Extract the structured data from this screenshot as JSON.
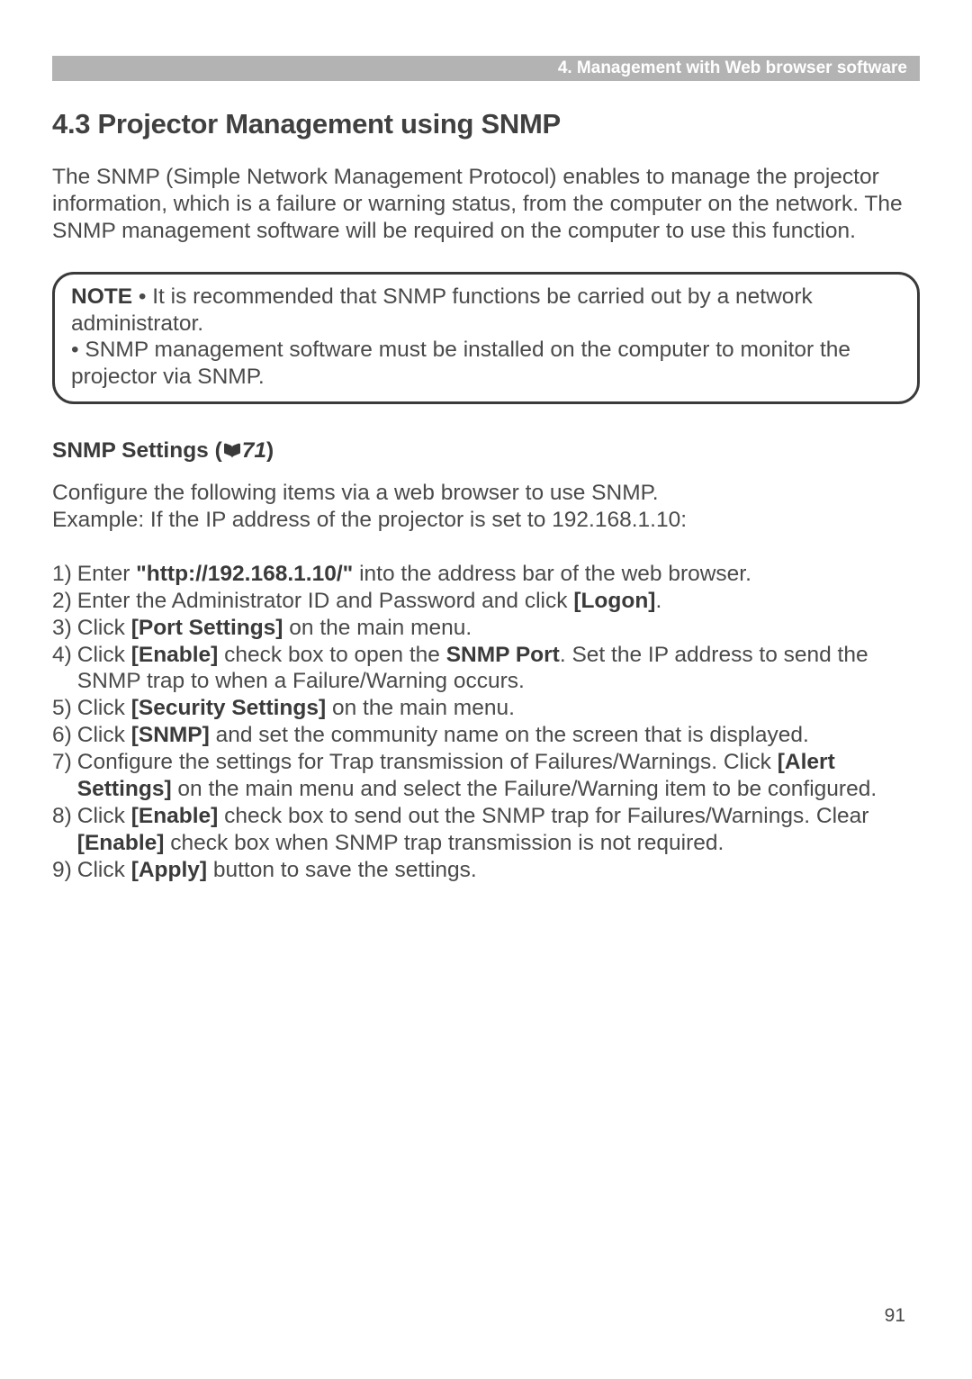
{
  "header": {
    "breadcrumb": "4. Management with Web browser software"
  },
  "section": {
    "title": "4.3 Projector Management using SNMP",
    "intro": "The SNMP (Simple Network Management Protocol) enables to manage the projector information, which is a failure or warning status, from the computer on the network. The SNMP management software will be required on the computer to use this function."
  },
  "note": {
    "label": "NOTE",
    "bullet1_a": " • It is recommended that SNMP functions be carried out by a network administrator.",
    "bullet2": "• SNMP management software must be installed on the computer to monitor the projector via SNMP."
  },
  "subsection": {
    "title_a": "SNMP Settings (",
    "ref": "71",
    "title_b": ")"
  },
  "config": {
    "line1": "Configure the following items via a web browser to use SNMP.",
    "line2": "Example: If the IP address of the projector is set to 192.168.1.10:"
  },
  "steps": {
    "s1": {
      "n": "1)",
      "a": "Enter ",
      "url": "\"http://192.168.1.10/\"",
      "b": " into the address bar of the web browser."
    },
    "s2": {
      "n": "2)",
      "a": "Enter the Administrator ID and Password and click ",
      "logon": "[Logon]",
      "b": "."
    },
    "s3": {
      "n": "3)",
      "a": "Click ",
      "port": "[Port Settings]",
      "b": " on the main menu."
    },
    "s4": {
      "n": "4)",
      "a": "Click ",
      "enable": "[Enable]",
      "b": " check box to open the ",
      "snmpport": "SNMP Port",
      "c": ". Set the IP address to send the SNMP trap to when a Failure/Warning occurs."
    },
    "s5": {
      "n": "5)",
      "a": "Click ",
      "sec": "[Security Settings]",
      "b": " on the main menu."
    },
    "s6": {
      "n": "6)",
      "a": "Click ",
      "snmp": "[SNMP]",
      "b": " and set the community name on the screen that is displayed."
    },
    "s7": {
      "n": "7)",
      "a": "Configure the settings for Trap transmission of Failures/Warnings. Click ",
      "alert": "[Alert Settings]",
      "b": " on the main menu and select the Failure/Warning item to be configured."
    },
    "s8": {
      "n": "8)",
      "a": "Click ",
      "enable": "[Enable]",
      "b": " check box to send out the SNMP trap for Failures/Warnings. Clear ",
      "enable2": "[Enable]",
      "c": " check box when SNMP trap transmission is not required."
    },
    "s9": {
      "n": "9)",
      "a": "Click ",
      "apply": "[Apply]",
      "b": " button to save the settings."
    }
  },
  "page_number": "91"
}
